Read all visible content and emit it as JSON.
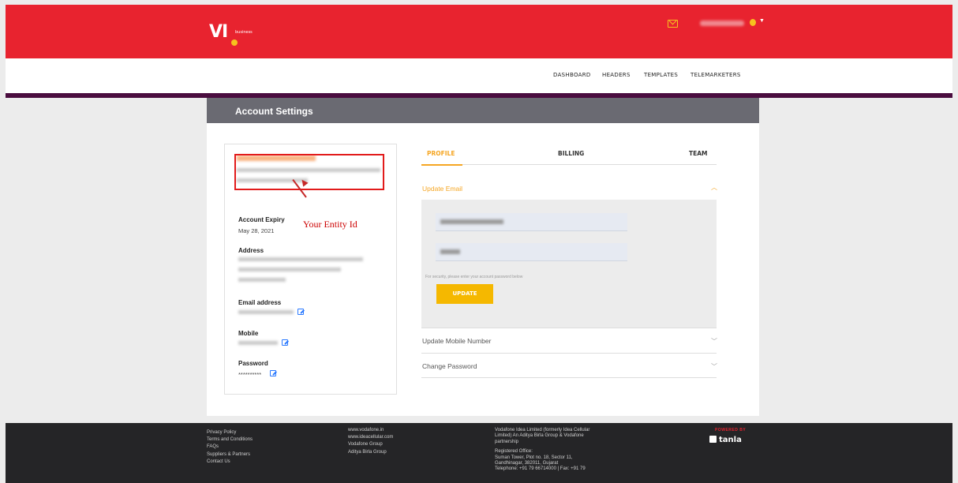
{
  "header": {
    "logo_text": "VI",
    "logo_sub": "business"
  },
  "nav": {
    "items": [
      "DASHBOARD",
      "HEADERS",
      "TEMPLATES",
      "TELEMARKETERS"
    ]
  },
  "account": {
    "title": "Account Settings",
    "annotation": "Your Entity Id",
    "expiry_label": "Account Expiry",
    "expiry_value": "May 28, 2021",
    "address_label": "Address",
    "email_label": "Email address",
    "mobile_label": "Mobile",
    "password_label": "Password",
    "password_value": "**********"
  },
  "tabs": {
    "profile": "PROFILE",
    "billing": "BILLING",
    "team": "TEAM"
  },
  "accordion": {
    "update_email": "Update Email",
    "security_hint": "For security, please enter your account password below",
    "update_button": "UPDATE",
    "update_mobile": "Update Mobile Number",
    "change_password": "Change Password"
  },
  "footer": {
    "col1": [
      "Privacy Policy",
      "Terms and Conditions",
      "FAQs",
      "Suppliers & Partners",
      "Contact Us"
    ],
    "col2": [
      "www.vodafone.in",
      "www.ideacellular.com",
      "Vodafone Group",
      "Aditya Birla Group"
    ],
    "col3": [
      "Vodafone Idea Limited (formerly Idea Cellular",
      "Limited) An Aditya Birla Group & Vodafone",
      "partnership",
      "",
      "Registered Office:",
      "Suman Tower, Plot no. 18, Sector 11,",
      "Gandhinagar, 382011, Gujarat",
      "Telephone: +91 79 66714000 | Fax: +91 79"
    ],
    "powered_by": "POWERED BY",
    "brand": "tanla"
  },
  "colors": {
    "brand_red": "#e8232f",
    "accent_yellow": "#f5b800",
    "header_gray": "#6a6a72",
    "footer_bg": "#252527"
  }
}
